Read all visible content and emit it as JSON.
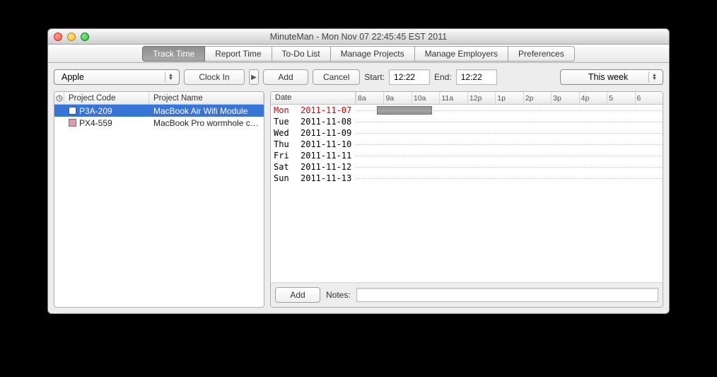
{
  "window": {
    "title": "MinuteMan - Mon Nov 07 22:45:45 EST 2011"
  },
  "tabs": {
    "items": [
      {
        "label": "Track Time",
        "active": true
      },
      {
        "label": "Report Time",
        "active": false
      },
      {
        "label": "To-Do List",
        "active": false
      },
      {
        "label": "Manage Projects",
        "active": false
      },
      {
        "label": "Manage Employers",
        "active": false
      },
      {
        "label": "Preferences",
        "active": false
      }
    ]
  },
  "employer_select": {
    "value": "Apple"
  },
  "clock_button": "Clock In",
  "add_button": "Add",
  "cancel_button": "Cancel",
  "start": {
    "label": "Start:",
    "value": "12:22"
  },
  "end": {
    "label": "End:",
    "value": "12:22"
  },
  "range_select": {
    "value": "This week"
  },
  "projects": {
    "headers": {
      "code": "Project Code",
      "name": "Project Name"
    },
    "rows": [
      {
        "code": "P3A-209",
        "name": "MacBook Air Wifi Module",
        "color": "white",
        "selected": true
      },
      {
        "code": "PX4-559",
        "name": "MacBook Pro wormhole c…",
        "color": "pink",
        "selected": false
      }
    ]
  },
  "schedule": {
    "date_header": "Date",
    "hours": [
      "8a",
      "9a",
      "10a",
      "11a",
      "12p",
      "1p",
      "2p",
      "3p",
      "4p",
      "5",
      "6"
    ],
    "days": [
      {
        "dow": "Mon",
        "date": "2011-11-07",
        "today": true,
        "bar": {
          "startPct": 7,
          "widthPct": 18
        }
      },
      {
        "dow": "Tue",
        "date": "2011-11-08",
        "today": false
      },
      {
        "dow": "Wed",
        "date": "2011-11-09",
        "today": false
      },
      {
        "dow": "Thu",
        "date": "2011-11-10",
        "today": false
      },
      {
        "dow": "Fri",
        "date": "2011-11-11",
        "today": false
      },
      {
        "dow": "Sat",
        "date": "2011-11-12",
        "today": false
      },
      {
        "dow": "Sun",
        "date": "2011-11-13",
        "today": false
      }
    ]
  },
  "notes": {
    "add": "Add",
    "label": "Notes:",
    "value": ""
  }
}
